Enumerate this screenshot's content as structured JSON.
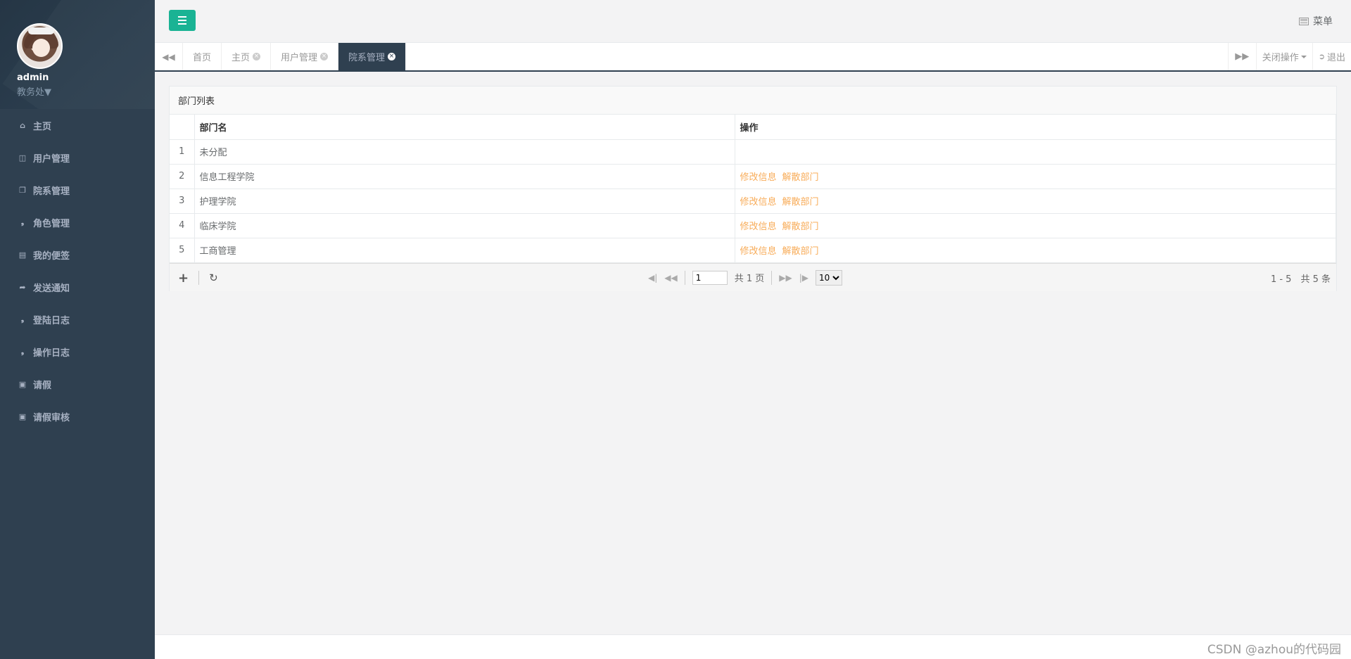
{
  "sidebar": {
    "username": "admin",
    "role": "教务处▼",
    "items": [
      {
        "label": "主页",
        "icon": "home-icon"
      },
      {
        "label": "用户管理",
        "icon": "columns-icon"
      },
      {
        "label": "院系管理",
        "icon": "copy-icon"
      },
      {
        "label": "角色管理",
        "icon": "tags-icon"
      },
      {
        "label": "我的便签",
        "icon": "note-icon"
      },
      {
        "label": "发送通知",
        "icon": "share-icon"
      },
      {
        "label": "登陆日志",
        "icon": "tags-icon"
      },
      {
        "label": "操作日志",
        "icon": "tags-icon"
      },
      {
        "label": "请假",
        "icon": "calendar-plus-icon"
      },
      {
        "label": "请假审核",
        "icon": "calendar-check-icon"
      }
    ]
  },
  "topbar": {
    "menu_label": "菜单"
  },
  "tabs": {
    "items": [
      {
        "label": "首页",
        "closable": false,
        "active": false
      },
      {
        "label": "主页",
        "closable": true,
        "active": false
      },
      {
        "label": "用户管理",
        "closable": true,
        "active": false
      },
      {
        "label": "院系管理",
        "closable": true,
        "active": true
      }
    ],
    "close_ops_label": "关闭操作",
    "logout_label": "退出"
  },
  "panel": {
    "title": "部门列表",
    "columns": [
      "部门名",
      "操作"
    ],
    "rows": [
      {
        "index": "1",
        "name": "未分配",
        "actions": []
      },
      {
        "index": "2",
        "name": "信息工程学院",
        "actions": [
          "修改信息",
          "解散部门"
        ]
      },
      {
        "index": "3",
        "name": "护理学院",
        "actions": [
          "修改信息",
          "解散部门"
        ]
      },
      {
        "index": "4",
        "name": "临床学院",
        "actions": [
          "修改信息",
          "解散部门"
        ]
      },
      {
        "index": "5",
        "name": "工商管理",
        "actions": [
          "修改信息",
          "解散部门"
        ]
      }
    ],
    "pager": {
      "current_page": "1",
      "total_pages_text": "共 1 页",
      "page_size": "10",
      "page_size_options": [
        "10"
      ],
      "summary": "1 - 5　共 5 条"
    }
  },
  "watermark": "CSDN @azhou的代码园",
  "colors": {
    "sidebar_bg": "#2f4050",
    "accent": "#1ab394",
    "action_link": "#f8ac59"
  }
}
